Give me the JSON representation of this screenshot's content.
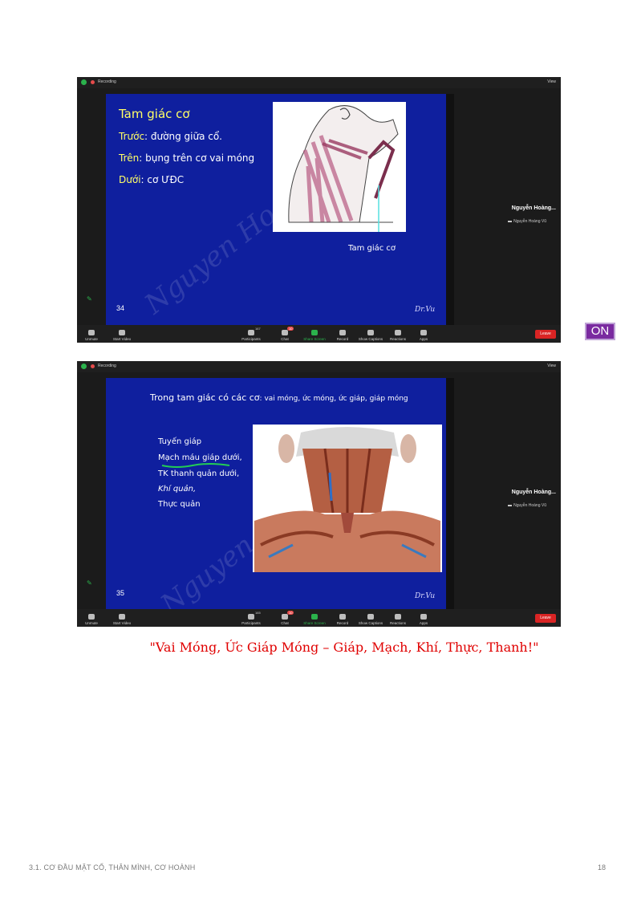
{
  "zoom": {
    "recording_label": "Recording",
    "view_label": "View",
    "participant_name": "Nguyễn Hoàng...",
    "participant_sub": "Nguyễn Hoàng Vũ",
    "toolbar": {
      "unmute": "Unmute",
      "start_video": "Start Video",
      "participants": "Participants",
      "participants_count_1": "167",
      "participants_count_2": "165",
      "chat": "Chat",
      "chat_badge": "10",
      "share_screen": "Share Screen",
      "record": "Record",
      "captions": "Show Captions",
      "reactions": "Reactions",
      "apps": "Apps",
      "leave": "Leave"
    }
  },
  "slide1": {
    "title": "Tam giác cơ",
    "lines": [
      {
        "key": "Trước",
        "rest": ": đường giữa cổ."
      },
      {
        "key": "Trên",
        "rest": ": bụng trên cơ vai móng"
      },
      {
        "key": "Dưới",
        "rest": ": cơ ƯĐC"
      }
    ],
    "caption": "Tam giác cơ",
    "number": "34",
    "signature": "Dr.Vu",
    "watermark": "Nguyen Hoang Vu"
  },
  "slide2": {
    "title_main": "Trong tam giác có các cơ",
    "title_rest": ": vai móng, ức móng, ức giáp, giáp móng",
    "items": [
      "Tuyến giáp",
      "Mạch máu giáp dưới,",
      "TK thanh quản dưới,",
      "Khí quản,",
      "Thực quản"
    ],
    "number": "35",
    "signature": "Dr.Vu",
    "watermark": "Nguyen Hoang Vu"
  },
  "on_badge": "ON",
  "mnemonic": "\"Vai Móng, Ức Giáp Móng – Giáp, Mạch, Khí, Thực, Thanh!\"",
  "footer": {
    "section": "3.1. CƠ ĐẦU MẶT CỔ, THÂN MÌNH, CƠ HOÀNH",
    "page": "18"
  },
  "colors": {
    "slide_bg": "#0f1f9e",
    "title_yellow": "#ffff66",
    "mnemonic_red": "#e00000",
    "on_purple": "#7a2aa0",
    "zoom_green": "#2bb24c",
    "leave_red": "#d92424"
  }
}
